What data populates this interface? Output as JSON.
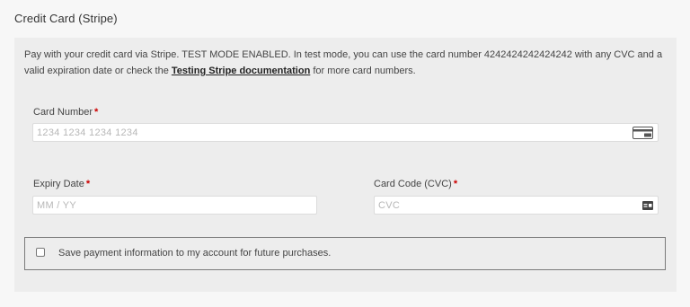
{
  "section_title": "Credit Card (Stripe)",
  "description": {
    "text_before_link": "Pay with your credit card via Stripe. TEST MODE ENABLED. In test mode, you can use the card number 4242424242424242 with any CVC and a valid expiration date or check the ",
    "link_text": "Testing Stripe documentation",
    "text_after_link": " for more card numbers."
  },
  "card_number": {
    "label": "Card Number",
    "required_mark": "*",
    "placeholder": "1234 1234 1234 1234",
    "icon": "credit-card-icon"
  },
  "expiry": {
    "label": "Expiry Date",
    "required_mark": "*",
    "placeholder": "MM / YY"
  },
  "cvc": {
    "label": "Card Code (CVC)",
    "required_mark": "*",
    "placeholder": "CVC",
    "icon": "cvc-card-icon"
  },
  "save_payment": {
    "label": "Save payment information to my account for future purchases.",
    "checked": false
  },
  "colors": {
    "required": "#cc0000",
    "panel_background": "#ededed",
    "page_background": "#f7f7f7"
  }
}
